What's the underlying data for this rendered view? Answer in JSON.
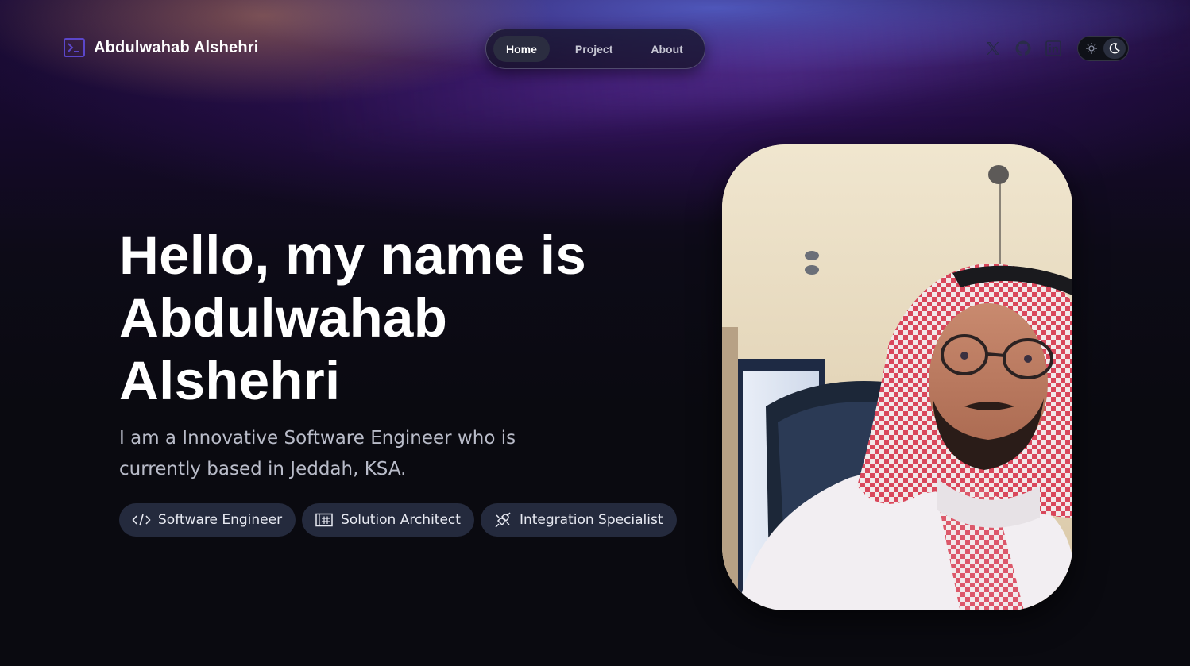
{
  "header": {
    "brand_name": "Abdulwahab Alshehri",
    "brand_icon": "terminal-icon"
  },
  "nav": {
    "items": [
      {
        "label": "Home",
        "active": true
      },
      {
        "label": "Project",
        "active": false
      },
      {
        "label": "About",
        "active": false
      }
    ]
  },
  "socials": [
    {
      "icon": "x-twitter-icon"
    },
    {
      "icon": "github-icon"
    },
    {
      "icon": "linkedin-icon"
    }
  ],
  "theme_toggle": {
    "options": [
      "sun-icon",
      "moon-icon"
    ],
    "selected": "moon-icon"
  },
  "hero": {
    "title_line1": "Hello, my name is",
    "title_line2": "Abdulwahab",
    "title_line3": "Alshehri",
    "subtitle": "I am a Innovative Software Engineer who is currently based in Jeddah, KSA.",
    "chips": [
      {
        "icon": "code-icon",
        "label": "Software Engineer"
      },
      {
        "icon": "architecture-icon",
        "label": "Solution Architect"
      },
      {
        "icon": "integration-icon",
        "label": "Integration Specialist"
      }
    ]
  },
  "colors": {
    "background": "#0a0a10",
    "chip_bg": "#242a3d",
    "nav_active_bg": "#2b2d40",
    "subtitle_text": "#b9bcc9"
  }
}
